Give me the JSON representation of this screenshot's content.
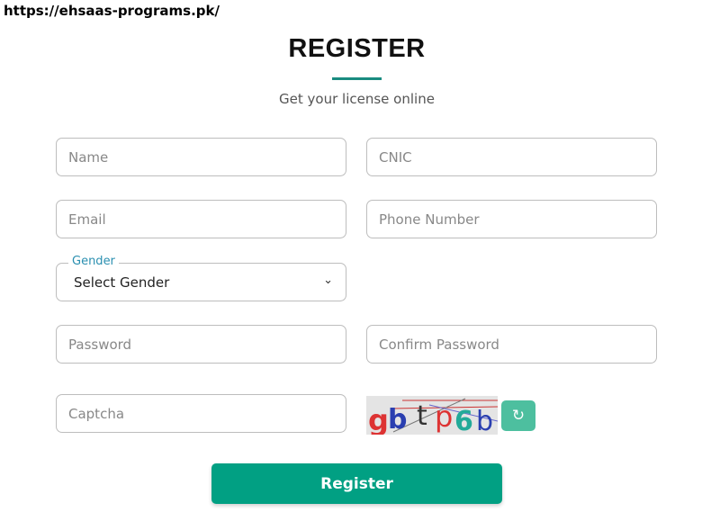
{
  "url": "https://ehsaas-programs.pk/",
  "title": "REGISTER",
  "subtitle": "Get your license online",
  "fields": {
    "name": "Name",
    "cnic": "CNIC",
    "email": "Email",
    "phone": "Phone Number",
    "password": "Password",
    "confirm": "Confirm Password",
    "captcha": "Captcha"
  },
  "gender": {
    "label": "Gender",
    "value": "Select Gender"
  },
  "captcha_text": "gbtp6b",
  "register_label": "Register",
  "colors": {
    "accent": "#01a083",
    "refresh": "#4dbf9f",
    "label": "#2a8fb0"
  },
  "icons": {
    "refresh": "refresh-icon",
    "chevron": "chevron-down-icon"
  }
}
